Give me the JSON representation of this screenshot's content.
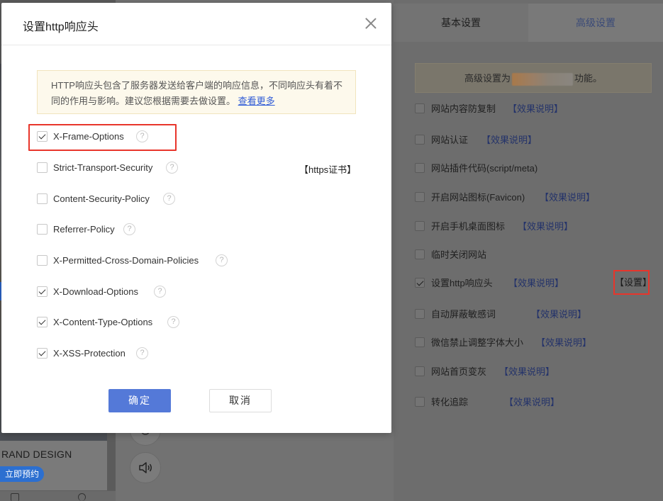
{
  "modal": {
    "title": "设置http响应头",
    "info_text": "HTTP响应头包含了服务器发送给客户端的响应信息，不同响应头有着不同的作用与影响。建议您根据需要去做设置。",
    "info_link": "查看更多",
    "headers": [
      {
        "label": "X-Frame-Options",
        "checked": true
      },
      {
        "label": "Strict-Transport-Security",
        "checked": false
      },
      {
        "label": "Content-Security-Policy",
        "checked": false
      },
      {
        "label": "Referrer-Policy",
        "checked": false
      },
      {
        "label": "X-Permitted-Cross-Domain-Policies",
        "checked": false
      },
      {
        "label": "X-Download-Options",
        "checked": true
      },
      {
        "label": "X-Content-Type-Options",
        "checked": true
      },
      {
        "label": "X-XSS-Protection",
        "checked": true
      }
    ],
    "https_link": "【https证书】",
    "help_glyph": "?",
    "ok_label": "确定",
    "cancel_label": "取消"
  },
  "tabs": {
    "basic": "基本设置",
    "advanced": "高级设置"
  },
  "advanced_notice": {
    "prefix": "高级设置为",
    "suffix": "功能。"
  },
  "advanced_options": [
    {
      "label": "网站内容防复制",
      "checked": false,
      "link": "【效果说明】"
    },
    {
      "label": "网站认证",
      "checked": false,
      "link": "【效果说明】"
    },
    {
      "label": "网站插件代码(script/meta)",
      "checked": false,
      "link": ""
    },
    {
      "label": "开启网站图标(Favicon)",
      "checked": false,
      "link": "【效果说明】"
    },
    {
      "label": "开启手机桌面图标",
      "checked": false,
      "link": "【效果说明】"
    },
    {
      "label": "临时关闭网站",
      "checked": false,
      "link": ""
    },
    {
      "label": "设置http响应头",
      "checked": true,
      "link": "【效果说明】"
    },
    {
      "label": "自动屏蔽敏感词",
      "checked": false,
      "link": "【效果说明】"
    },
    {
      "label": "微信禁止调整字体大小",
      "checked": false,
      "link": "【效果说明】"
    },
    {
      "label": "网站首页变灰",
      "checked": false,
      "link": "【效果说明】"
    },
    {
      "label": "转化追踪",
      "checked": false,
      "link": "【效果说明】"
    }
  ],
  "set_button_label": "【设置】",
  "background": {
    "brand_text": "RAND DESIGN",
    "book_button": "立即预约"
  },
  "colors": {
    "primary_button": "#5479d8",
    "highlight_border": "#e8352b",
    "link": "#2f5bd6",
    "info_bg": "#fdf9ec"
  }
}
